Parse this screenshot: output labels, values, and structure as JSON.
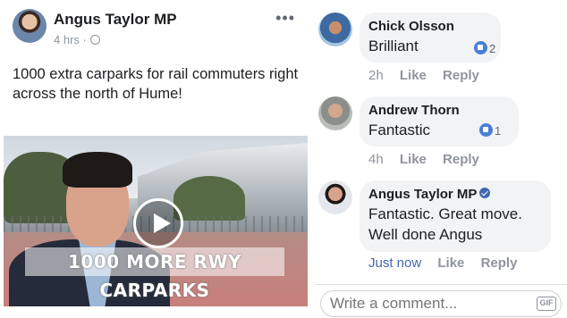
{
  "post": {
    "author": "Angus Taylor MP",
    "time": "4 hrs",
    "separator": "·",
    "more_label": "•••",
    "text": "1000 extra carparks for rail commuters right across the north of Hume!",
    "video_caption": "1000 MORE RWY CARPARKS",
    "icons": {
      "privacy": "globe-icon",
      "play": "play-icon",
      "more": "more-dots-icon"
    }
  },
  "comments": [
    {
      "author": "Chick Olsson",
      "text": "Brilliant",
      "time": "2h",
      "like_label": "Like",
      "reply_label": "Reply",
      "reactions": "2",
      "verified": false
    },
    {
      "author": "Andrew Thorn",
      "text": "Fantastic",
      "time": "4h",
      "like_label": "Like",
      "reply_label": "Reply",
      "reactions": "1",
      "verified": false
    },
    {
      "author": "Angus Taylor MP",
      "text_line1": "Fantastic. Great move.",
      "text_line2": "Well done Angus",
      "time": "Just now",
      "like_label": "Like",
      "reply_label": "Reply",
      "verified": true
    }
  ],
  "composer": {
    "placeholder": "Write a comment...",
    "gif_label": "GIF"
  },
  "colors": {
    "link_blue": "#4267b2",
    "bubble_bg": "#f2f3f5",
    "meta_gray": "#90949c",
    "reaction_blue": "#4a7ed8"
  }
}
